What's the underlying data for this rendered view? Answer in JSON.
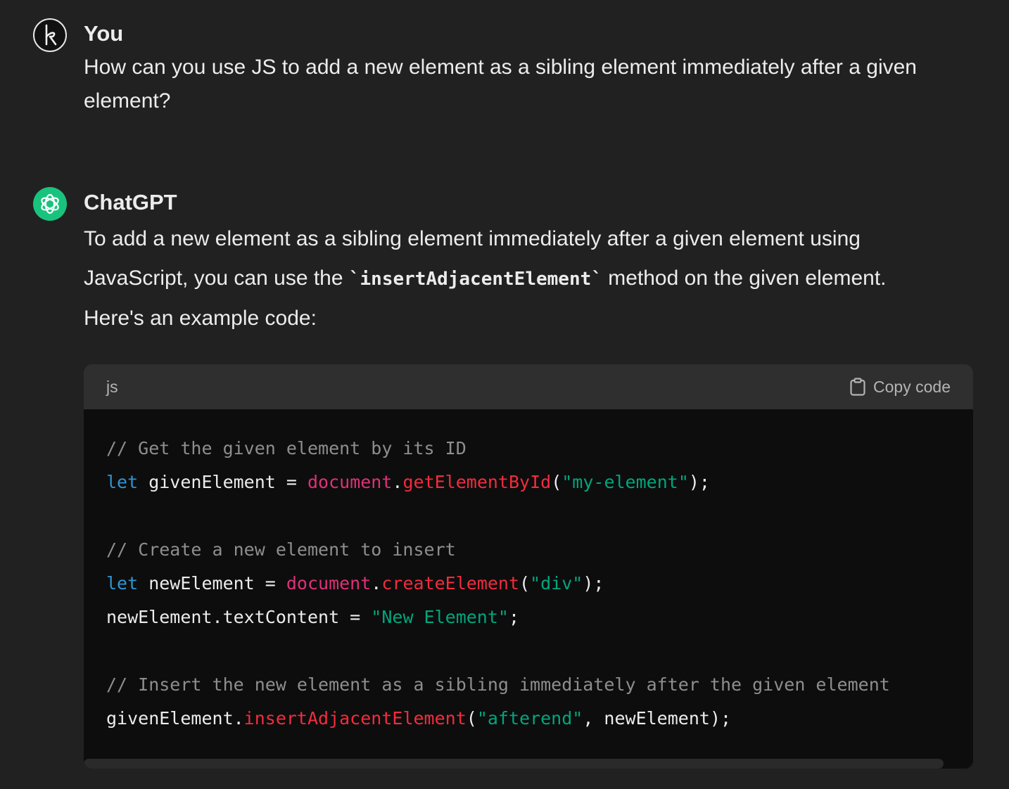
{
  "user_message": {
    "sender": "You",
    "avatar_letter": "k",
    "text": "How can you use JS to add a new element as a sibling element immediately after a given element?"
  },
  "assistant_message": {
    "sender": "ChatGPT",
    "avatar_icon": "openai-logo-icon",
    "text_part1": "To add a new element as a sibling element immediately after a given element using JavaScript, you can use the ",
    "inline_code": "`insertAdjacentElement`",
    "text_part2": " method on the given element. Here's an example code:"
  },
  "code_block": {
    "language": "js",
    "copy_label": "Copy code",
    "copy_icon": "clipboard-icon",
    "lines": [
      [
        {
          "t": "// Get the given element by its ID",
          "c": "comment"
        }
      ],
      [
        {
          "t": "let",
          "c": "kw"
        },
        {
          "t": " givenElement = ",
          "c": "plain"
        },
        {
          "t": "document",
          "c": "obj"
        },
        {
          "t": ".",
          "c": "plain"
        },
        {
          "t": "getElementById",
          "c": "fn"
        },
        {
          "t": "(",
          "c": "plain"
        },
        {
          "t": "\"my-element\"",
          "c": "str"
        },
        {
          "t": ");",
          "c": "plain"
        }
      ],
      [],
      [
        {
          "t": "// Create a new element to insert",
          "c": "comment"
        }
      ],
      [
        {
          "t": "let",
          "c": "kw"
        },
        {
          "t": " newElement = ",
          "c": "plain"
        },
        {
          "t": "document",
          "c": "obj"
        },
        {
          "t": ".",
          "c": "plain"
        },
        {
          "t": "createElement",
          "c": "fn"
        },
        {
          "t": "(",
          "c": "plain"
        },
        {
          "t": "\"div\"",
          "c": "str"
        },
        {
          "t": ");",
          "c": "plain"
        }
      ],
      [
        {
          "t": "newElement.textContent = ",
          "c": "plain"
        },
        {
          "t": "\"New Element\"",
          "c": "str"
        },
        {
          "t": ";",
          "c": "plain"
        }
      ],
      [],
      [
        {
          "t": "// Insert the new element as a sibling immediately after the given element",
          "c": "comment"
        }
      ],
      [
        {
          "t": "givenElement.",
          "c": "plain"
        },
        {
          "t": "insertAdjacentElement",
          "c": "fn"
        },
        {
          "t": "(",
          "c": "plain"
        },
        {
          "t": "\"afterend\"",
          "c": "str"
        },
        {
          "t": ", newElement);",
          "c": "plain"
        }
      ]
    ]
  },
  "colors": {
    "background": "#212121",
    "code_background": "#0d0d0d",
    "code_header": "#2f2f2f",
    "keyword": "#2e95d3",
    "object": "#df3079",
    "function": "#f22c3d",
    "string": "#00a67d",
    "comment": "#8e8e8e",
    "gpt_avatar": "#19c37d"
  }
}
